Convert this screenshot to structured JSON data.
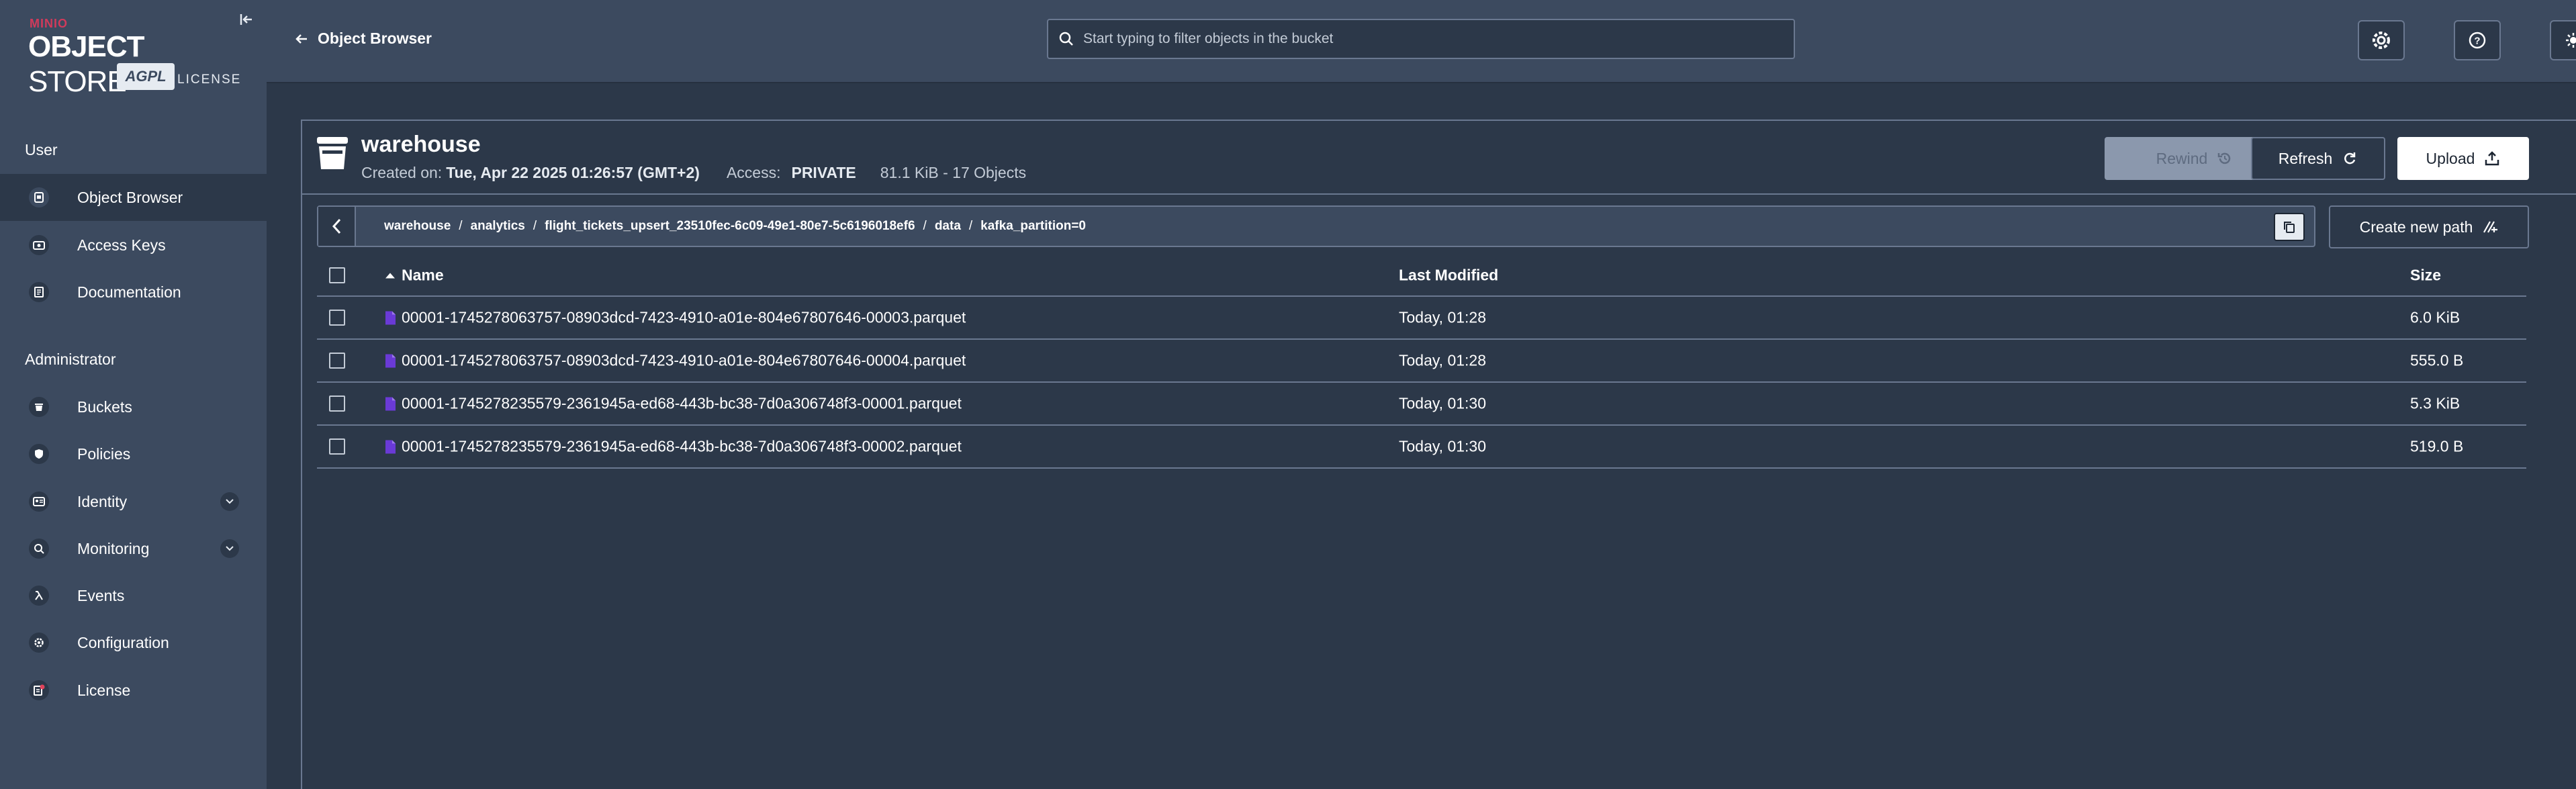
{
  "brand": {
    "minio": "MINIO",
    "object": "OBJECT",
    "store": " STORE",
    "agpl": "AGPL",
    "license": "LICENSE"
  },
  "sidebar": {
    "user_section": "User",
    "user_items": [
      {
        "label": "Object Browser",
        "icon": "object-browser-icon"
      },
      {
        "label": "Access Keys",
        "icon": "access-keys-icon"
      },
      {
        "label": "Documentation",
        "icon": "documentation-icon"
      }
    ],
    "admin_section": "Administrator",
    "admin_items": [
      {
        "label": "Buckets",
        "icon": "buckets-icon"
      },
      {
        "label": "Policies",
        "icon": "policies-icon"
      },
      {
        "label": "Identity",
        "icon": "identity-icon"
      },
      {
        "label": "Monitoring",
        "icon": "monitoring-icon"
      },
      {
        "label": "Events",
        "icon": "lambda-icon"
      },
      {
        "label": "Configuration",
        "icon": "configuration-icon"
      },
      {
        "label": "License",
        "icon": "license-icon"
      }
    ]
  },
  "header": {
    "back_label": "Object Browser",
    "search_placeholder": "Start typing to filter objects in the bucket"
  },
  "bucket": {
    "name": "warehouse",
    "created_label": "Created on:",
    "created_value": "Tue, Apr 22 2025 01:26:57 (GMT+2)",
    "access_label": "Access:",
    "access_value": "PRIVATE",
    "summary": "81.1 KiB - 17 Objects"
  },
  "actions": {
    "rewind": "Rewind",
    "refresh": "Refresh",
    "upload": "Upload",
    "create_path": "Create new path"
  },
  "breadcrumb": [
    "warehouse",
    "analytics",
    "flight_tickets_upsert_23510fec-6c09-49e1-80e7-5c6196018ef6",
    "data",
    "kafka_partition=0"
  ],
  "table": {
    "columns": {
      "name": "Name",
      "modified": "Last Modified",
      "size": "Size"
    },
    "rows": [
      {
        "name": "00001-1745278063757-08903dcd-7423-4910-a01e-804e67807646-00003.parquet",
        "modified": "Today, 01:28",
        "size": "6.0 KiB"
      },
      {
        "name": "00001-1745278063757-08903dcd-7423-4910-a01e-804e67807646-00004.parquet",
        "modified": "Today, 01:28",
        "size": "555.0 B"
      },
      {
        "name": "00001-1745278235579-2361945a-ed68-443b-bc38-7d0a306748f3-00001.parquet",
        "modified": "Today, 01:30",
        "size": "5.3 KiB"
      },
      {
        "name": "00001-1745278235579-2361945a-ed68-443b-bc38-7d0a306748f3-00002.parquet",
        "modified": "Today, 01:30",
        "size": "519.0 B"
      }
    ]
  },
  "colors": {
    "sidebar_bg": "#3c4a5f",
    "page_bg": "#2c3849",
    "accent_minio": "#d13a5b",
    "file_icon": "#6a3ad6"
  }
}
